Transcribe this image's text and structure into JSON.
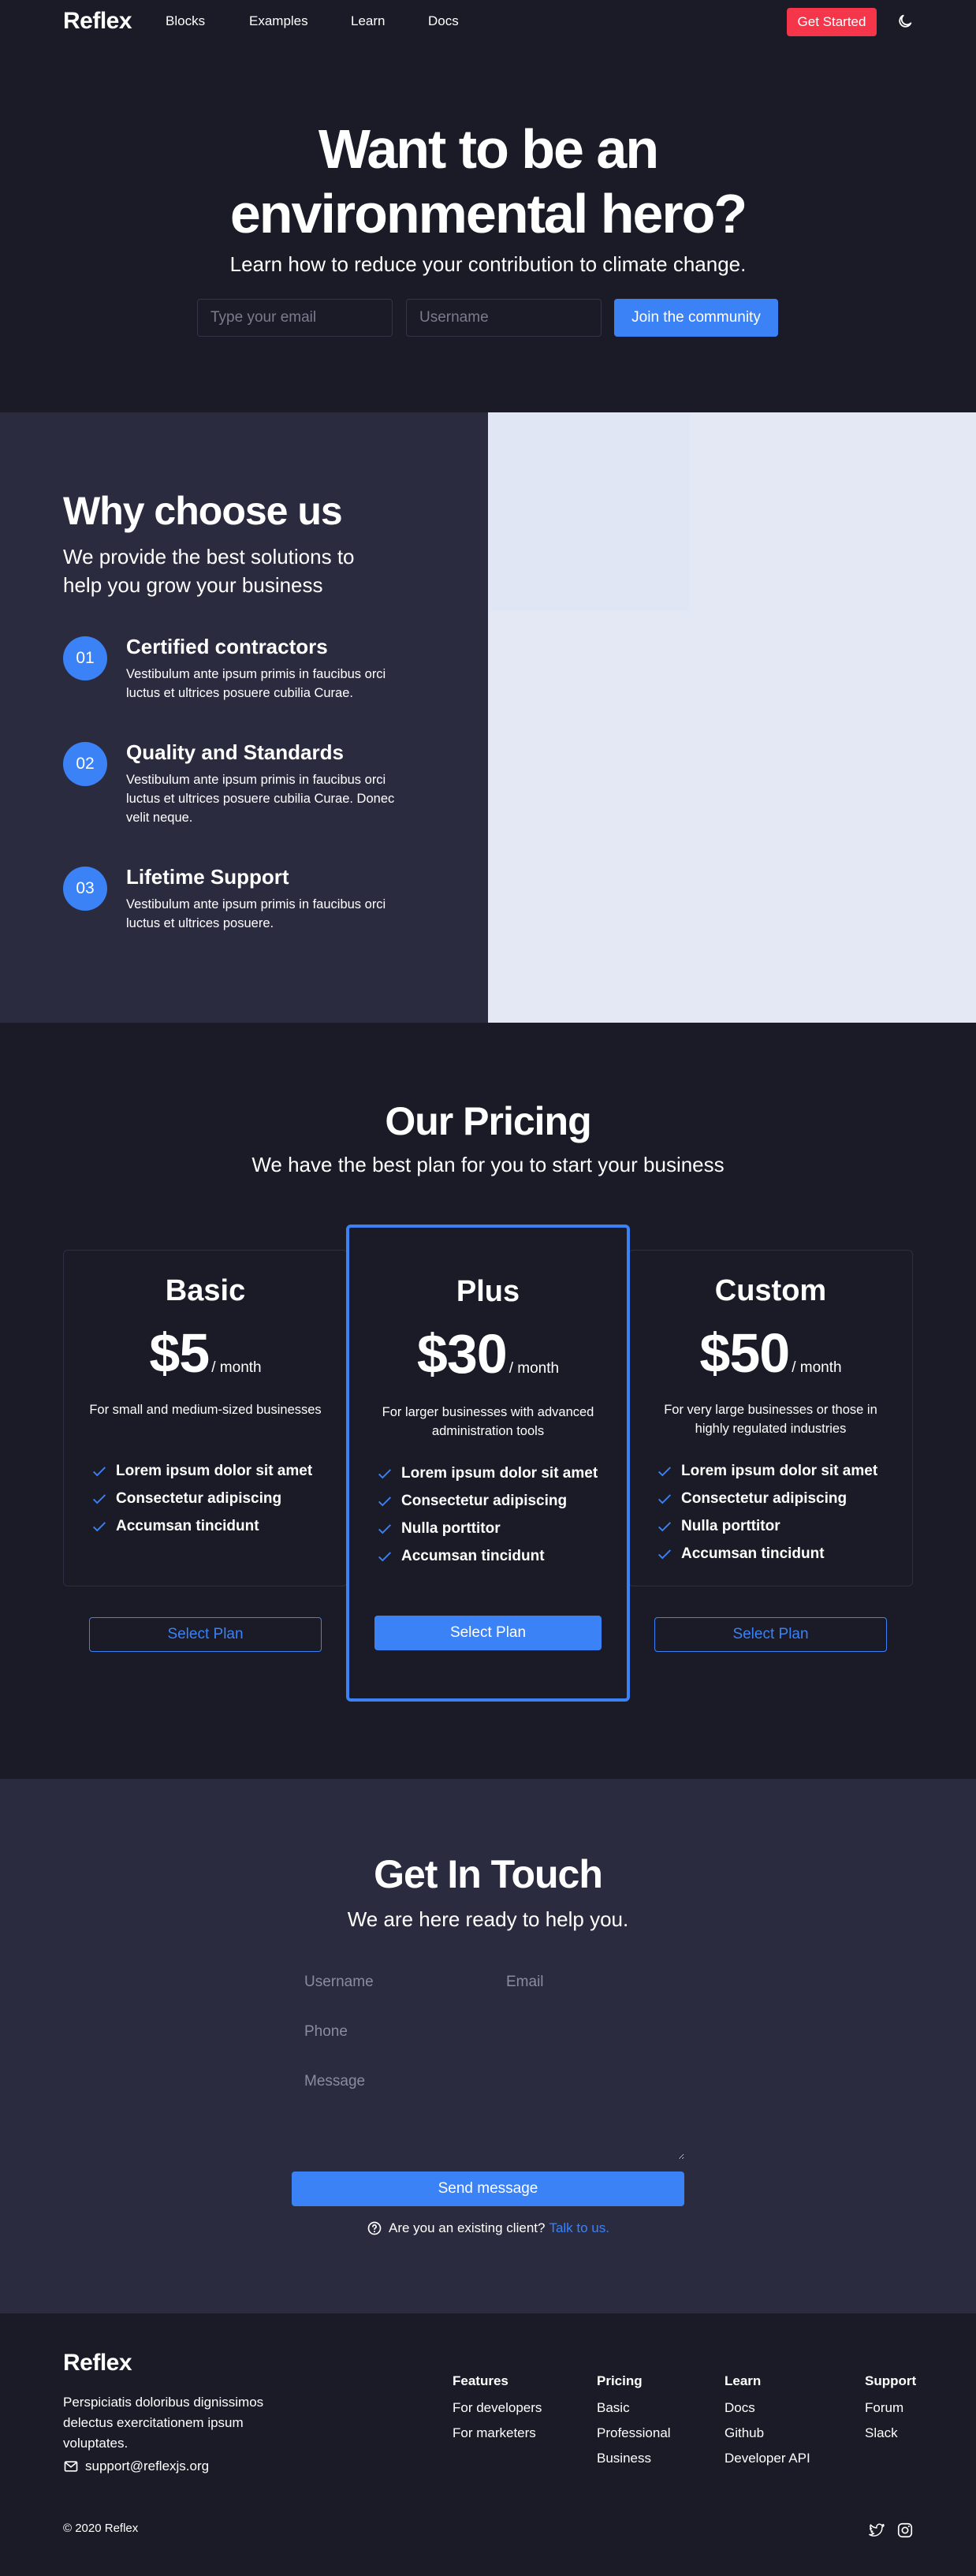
{
  "nav": {
    "logo": "Reflex",
    "links": [
      "Blocks",
      "Examples",
      "Learn",
      "Docs"
    ],
    "cta": "Get Started",
    "theme_icon": "moon-icon"
  },
  "hero": {
    "title_line1": "Want to be an",
    "title_line2": "environmental hero?",
    "subtitle": "Learn how to reduce your contribution to climate change.",
    "email_placeholder": "Type your email",
    "username_placeholder": "Username",
    "join_label": "Join the community"
  },
  "why": {
    "title": "Why choose us",
    "subtitle": "We provide the best solutions to help you grow your business",
    "features": [
      {
        "num": "01",
        "title": "Certified contractors",
        "desc": "Vestibulum ante ipsum primis in faucibus orci luctus et ultrices posuere cubilia Curae."
      },
      {
        "num": "02",
        "title": "Quality and Standards",
        "desc": "Vestibulum ante ipsum primis in faucibus orci luctus et ultrices posuere cubilia Curae. Donec velit neque."
      },
      {
        "num": "03",
        "title": "Lifetime Support",
        "desc": "Vestibulum ante ipsum primis in faucibus orci luctus et ultrices posuere."
      }
    ]
  },
  "pricing": {
    "title": "Our Pricing",
    "subtitle": "We have the best plan for you to start your business",
    "plans": [
      {
        "name": "Basic",
        "price": "$5",
        "period": "/ month",
        "desc": "For small and medium-sized businesses",
        "features": [
          "Lorem ipsum dolor sit amet",
          "Consectetur adipiscing",
          "Accumsan tincidunt"
        ],
        "button": "Select Plan"
      },
      {
        "name": "Plus",
        "price": "$30",
        "period": "/ month",
        "desc": "For larger businesses with advanced administration tools",
        "features": [
          "Lorem ipsum dolor sit amet",
          "Consectetur adipiscing",
          "Nulla porttitor",
          "Accumsan tincidunt"
        ],
        "button": "Select Plan"
      },
      {
        "name": "Custom",
        "price": "$50",
        "period": "/ month",
        "desc": "For very large businesses or those in highly regulated industries",
        "features": [
          "Lorem ipsum dolor sit amet",
          "Consectetur adipiscing",
          "Nulla porttitor",
          "Accumsan tincidunt"
        ],
        "button": "Select Plan"
      }
    ]
  },
  "contact": {
    "title": "Get In Touch",
    "subtitle": "We are here ready to help you.",
    "username_placeholder": "Username",
    "email_placeholder": "Email",
    "phone_placeholder": "Phone",
    "message_placeholder": "Message",
    "send_label": "Send message",
    "hint_text": "Are you an existing client?",
    "hint_link": "Talk to us."
  },
  "footer": {
    "logo": "Reflex",
    "desc": "Perspiciatis doloribus dignissimos delectus exercitationem ipsum voluptates.",
    "email": "support@reflexjs.org",
    "columns": [
      {
        "head": "Features",
        "links": [
          "For developers",
          "For marketers"
        ]
      },
      {
        "head": "Pricing",
        "links": [
          "Basic",
          "Professional",
          "Business"
        ]
      },
      {
        "head": "Learn",
        "links": [
          "Docs",
          "Github",
          "Developer API"
        ]
      },
      {
        "head": "Support",
        "links": [
          "Forum",
          "Slack"
        ]
      }
    ],
    "copyright": "© 2020 Reflex",
    "social_icons": [
      "twitter-icon",
      "instagram-icon"
    ]
  },
  "colors": {
    "background": "#1a1b26",
    "section_alt": "#2b2b3f",
    "accent_blue": "#3b82f6",
    "accent_red": "#f5364a",
    "image_placeholder": "#e3e8f4"
  }
}
